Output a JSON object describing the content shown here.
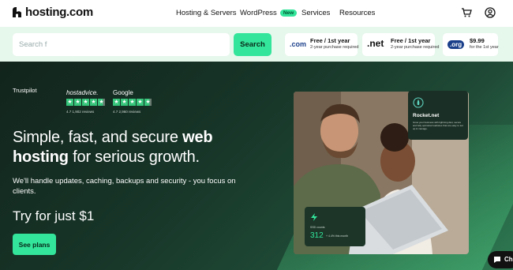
{
  "header": {
    "logo_text": "hosting.com",
    "nav": [
      "Hosting & Servers",
      "WordPress",
      "Services",
      "Resources"
    ],
    "wordpress_badge": "New",
    "cart_icon": "cart-icon",
    "account_icon": "user-circle-icon"
  },
  "search": {
    "placeholder": "Search f",
    "button_label": "Search"
  },
  "promos": [
    {
      "tld": ".com",
      "title": "Free / 1st year",
      "sub": "2-year purchase required"
    },
    {
      "tld": ".net",
      "title": "Free / 1st year",
      "sub": "2-year purchase required"
    },
    {
      "tld": ".org",
      "title": "$9.99",
      "sub": "for the 1st year"
    }
  ],
  "reviews": {
    "trustpilot": "Trustpilot",
    "hostadvice": "hostadvice.",
    "hostadvice_score": "4.7 1,902 reviews",
    "google": "Google",
    "google_score": "4.7 2,960 reviews"
  },
  "hero": {
    "headline_a": "Simple, fast, and secure ",
    "headline_b": "web hosting",
    "headline_c": " for serious growth.",
    "subtext": "We'll handle updates, caching, backups and security - you focus on clients.",
    "try_text": "Try for just $1",
    "cta_label": "See plans"
  },
  "cards": {
    "rocket_title": "Rocket.net",
    "rocket_text": "Grow your business with lightning-fast, secure and fully optimized websites that are easy to set up & manage.",
    "stat_label": "SSD counts",
    "stat_value": "312",
    "stat_delta": "+ 4.4% this month"
  },
  "chat": {
    "label": "Ch"
  },
  "colors": {
    "accent": "#33e59a",
    "hero_dark": "#12241c",
    "search_band": "#e6f7ec",
    "tld_blue": "#1a3f8a"
  }
}
